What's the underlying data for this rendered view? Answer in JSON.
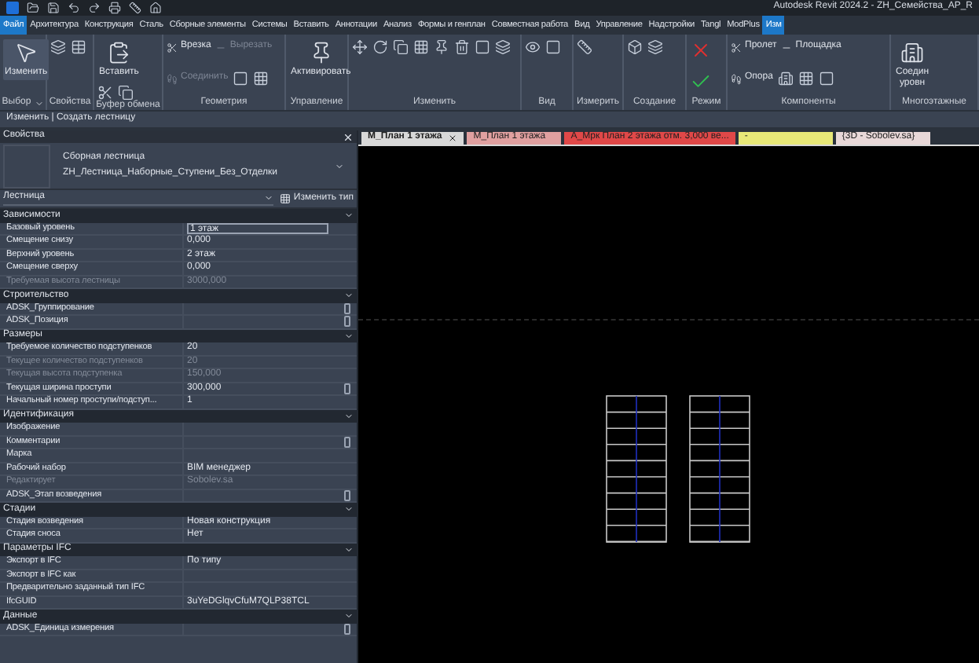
{
  "window": {
    "title": "Autodesk Revit 2024.2 - ZH_Семейства_АР_R"
  },
  "menu_tabs": [
    {
      "label": "Файл",
      "selected": true
    },
    {
      "label": "Архитектура",
      "selected": false
    },
    {
      "label": "Конструкция",
      "selected": false
    },
    {
      "label": "Сталь",
      "selected": false
    },
    {
      "label": "Сборные элементы",
      "selected": false
    },
    {
      "label": "Системы",
      "selected": false
    },
    {
      "label": "Вставить",
      "selected": false
    },
    {
      "label": "Аннотации",
      "selected": false
    },
    {
      "label": "Анализ",
      "selected": false
    },
    {
      "label": "Формы и генплан",
      "selected": false
    },
    {
      "label": "Совместная работа",
      "selected": false
    },
    {
      "label": "Вид",
      "selected": false
    },
    {
      "label": "Управление",
      "selected": false
    },
    {
      "label": "Надстройки",
      "selected": false
    },
    {
      "label": "Tangl",
      "selected": false
    },
    {
      "label": "ModPlus",
      "selected": false
    },
    {
      "label": "Изм",
      "selected": true
    }
  ],
  "ribbon": [
    {
      "label": "Выбор",
      "dropdown": true,
      "items": [
        {
          "kind": "large",
          "label": "Изменить",
          "disabled": false
        }
      ]
    },
    {
      "label": "Свойства",
      "dropdown": false
    },
    {
      "label": "Буфер обмена",
      "dropdown": false,
      "items": [
        {
          "kind": "large",
          "label": "Вставить",
          "disabled": false
        }
      ]
    },
    {
      "label": "Геометрия",
      "dropdown": false,
      "items": [
        {
          "kind": "small",
          "label": "Врезка",
          "disabled": false
        },
        {
          "kind": "small",
          "label": "Вырезать",
          "disabled": true
        },
        {
          "kind": "small",
          "label": "Соединить",
          "disabled": true
        }
      ]
    },
    {
      "label": "Управление",
      "dropdown": false,
      "items": [
        {
          "kind": "large",
          "label": "Активировать",
          "disabled": false
        }
      ]
    },
    {
      "label": "Изменить",
      "dropdown": false
    },
    {
      "label": "Вид",
      "dropdown": false
    },
    {
      "label": "Измерить",
      "dropdown": false
    },
    {
      "label": "Создание",
      "dropdown": false
    },
    {
      "label": "Режим",
      "dropdown": false
    },
    {
      "label": "Компоненты",
      "dropdown": false,
      "items": [
        {
          "kind": "small",
          "label": "Пролет",
          "disabled": false
        },
        {
          "kind": "small",
          "label": "Площадка",
          "disabled": false
        },
        {
          "kind": "small",
          "label": "Опора",
          "disabled": false
        }
      ]
    },
    {
      "label": "Многоэтажные",
      "dropdown": false,
      "items": [
        {
          "kind": "large",
          "label": "Соедин\nуровн",
          "disabled": false
        }
      ]
    }
  ],
  "context_bar": "Изменить | Создать лестницу",
  "properties": {
    "title": "Свойства",
    "family": "Сборная лестница",
    "type": "ZH_Лестница_Наборные_Ступени_Без_Отделки",
    "category": "Лестница",
    "edit_type": "Изменить тип",
    "groups": [
      {
        "name": "Зависимости",
        "rows": [
          {
            "name": "Базовый уровень",
            "value": "1 этаж",
            "disabled": false,
            "editing": true
          },
          {
            "name": "Смещение снизу",
            "value": "0,000",
            "disabled": false,
            "editing": false
          },
          {
            "name": "Верхний уровень",
            "value": "2 этаж",
            "disabled": false,
            "editing": false
          },
          {
            "name": "Смещение сверху",
            "value": "0,000",
            "disabled": false,
            "editing": false
          },
          {
            "name": "Требуемая высота лестницы",
            "value": "3000,000",
            "disabled": true,
            "editing": false
          }
        ]
      },
      {
        "name": "Строительство",
        "rows": [
          {
            "name": "ADSK_Группирование",
            "disabled": false,
            "button": true
          },
          {
            "name": "ADSK_Позиция",
            "disabled": false,
            "button": true
          }
        ]
      },
      {
        "name": "Размеры",
        "rows": [
          {
            "name": "Требуемое количество подступенков",
            "value": "20",
            "disabled": false,
            "editing": false
          },
          {
            "name": "Текущее количество подступенков",
            "value": "20",
            "disabled": true,
            "editing": false
          },
          {
            "name": "Текущая высота подступенка",
            "value": "150,000",
            "disabled": true,
            "editing": false
          },
          {
            "name": "Текущая ширина проступи",
            "value": "300,000",
            "disabled": false,
            "editing": false,
            "button": true
          },
          {
            "name": "Начальный номер проступи/подступ...",
            "value": "1",
            "disabled": false,
            "editing": false
          }
        ]
      },
      {
        "name": "Идентификация",
        "rows": [
          {
            "name": "Изображение",
            "disabled": false
          },
          {
            "name": "Комментарии",
            "disabled": false,
            "button": true
          },
          {
            "name": "Марка",
            "disabled": false
          },
          {
            "name": "Рабочий набор",
            "value": "BIM менеджер",
            "disabled": false,
            "editing": false
          },
          {
            "name": "Редактирует",
            "value": "Sobolev.sa",
            "disabled": true,
            "editing": false
          },
          {
            "name": "ADSK_Этап возведения",
            "disabled": false,
            "button": true
          }
        ]
      },
      {
        "name": "Стадии",
        "rows": [
          {
            "name": "Стадия возведения",
            "value": "Новая конструкция",
            "disabled": false,
            "editing": false
          },
          {
            "name": "Стадия сноса",
            "value": "Нет",
            "disabled": false,
            "editing": false
          }
        ]
      },
      {
        "name": "Параметры IFC",
        "rows": [
          {
            "name": "Экспорт в IFC",
            "value": "По типу",
            "disabled": false,
            "editing": false
          },
          {
            "name": "Экспорт в IFC как",
            "disabled": false
          },
          {
            "name": "Предварительно заданный тип IFC",
            "disabled": false
          },
          {
            "name": "IfcGUID",
            "value": "3uYeDGlqvCfuM7QLP38TCL",
            "disabled": false,
            "editing": false
          }
        ]
      },
      {
        "name": "Данные",
        "rows": [
          {
            "name": "ADSK_Единица измерения",
            "disabled": false,
            "button": true
          }
        ]
      }
    ]
  },
  "view_tabs": [
    {
      "label": "M_План 1 этажа",
      "selected": true,
      "color": "#d8d8d8"
    },
    {
      "label": "M_План 1 этажа",
      "selected": false,
      "color": "#e0a0a0"
    },
    {
      "label": "A_Мрк План 2 этажа отм. 3,000 ве...",
      "selected": false,
      "color": "#e04848"
    },
    {
      "label": "-",
      "selected": false,
      "color": "#e8e878"
    },
    {
      "label": "{3D - Sobolev.sa}",
      "selected": false,
      "color": "#e8d8d8"
    }
  ]
}
